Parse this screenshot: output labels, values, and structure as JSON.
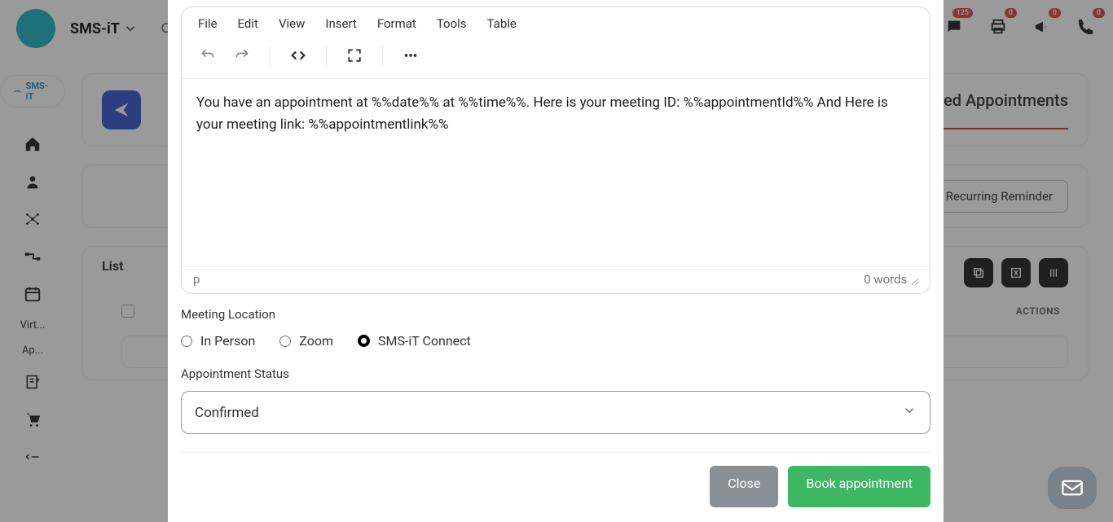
{
  "header": {
    "brand": "SMS-iT",
    "badges": {
      "messages": "125",
      "print": "0",
      "announce": "0",
      "phone": "0"
    }
  },
  "sidebar": {
    "logo_text": "SMS-iT",
    "items": [
      {
        "label": "Virt..."
      },
      {
        "label": "Ap..."
      }
    ]
  },
  "content": {
    "confirmed_title": "ed Appointments",
    "recurring_btn": "Recurring Reminder",
    "tab_list": "List",
    "actions_col": "ACTIONS"
  },
  "modal": {
    "editor_menu": {
      "file": "File",
      "edit": "Edit",
      "view": "View",
      "insert": "Insert",
      "format": "Format",
      "tools": "Tools",
      "table": "Table"
    },
    "editor_body": "You have an appointment at %%date%% at %%time%%. Here is your meeting ID: %%appointmentId%% And Here is your meeting link: %%appointmentlink%%",
    "editor_path": "p",
    "editor_words": "0 words",
    "meeting_location_label": "Meeting Location",
    "radio": {
      "in_person": "In Person",
      "zoom": "Zoom",
      "connect": "SMS-iT Connect"
    },
    "status_label": "Appointment Status",
    "status_value": "Confirmed",
    "close_btn": "Close",
    "book_btn": "Book appointment"
  }
}
